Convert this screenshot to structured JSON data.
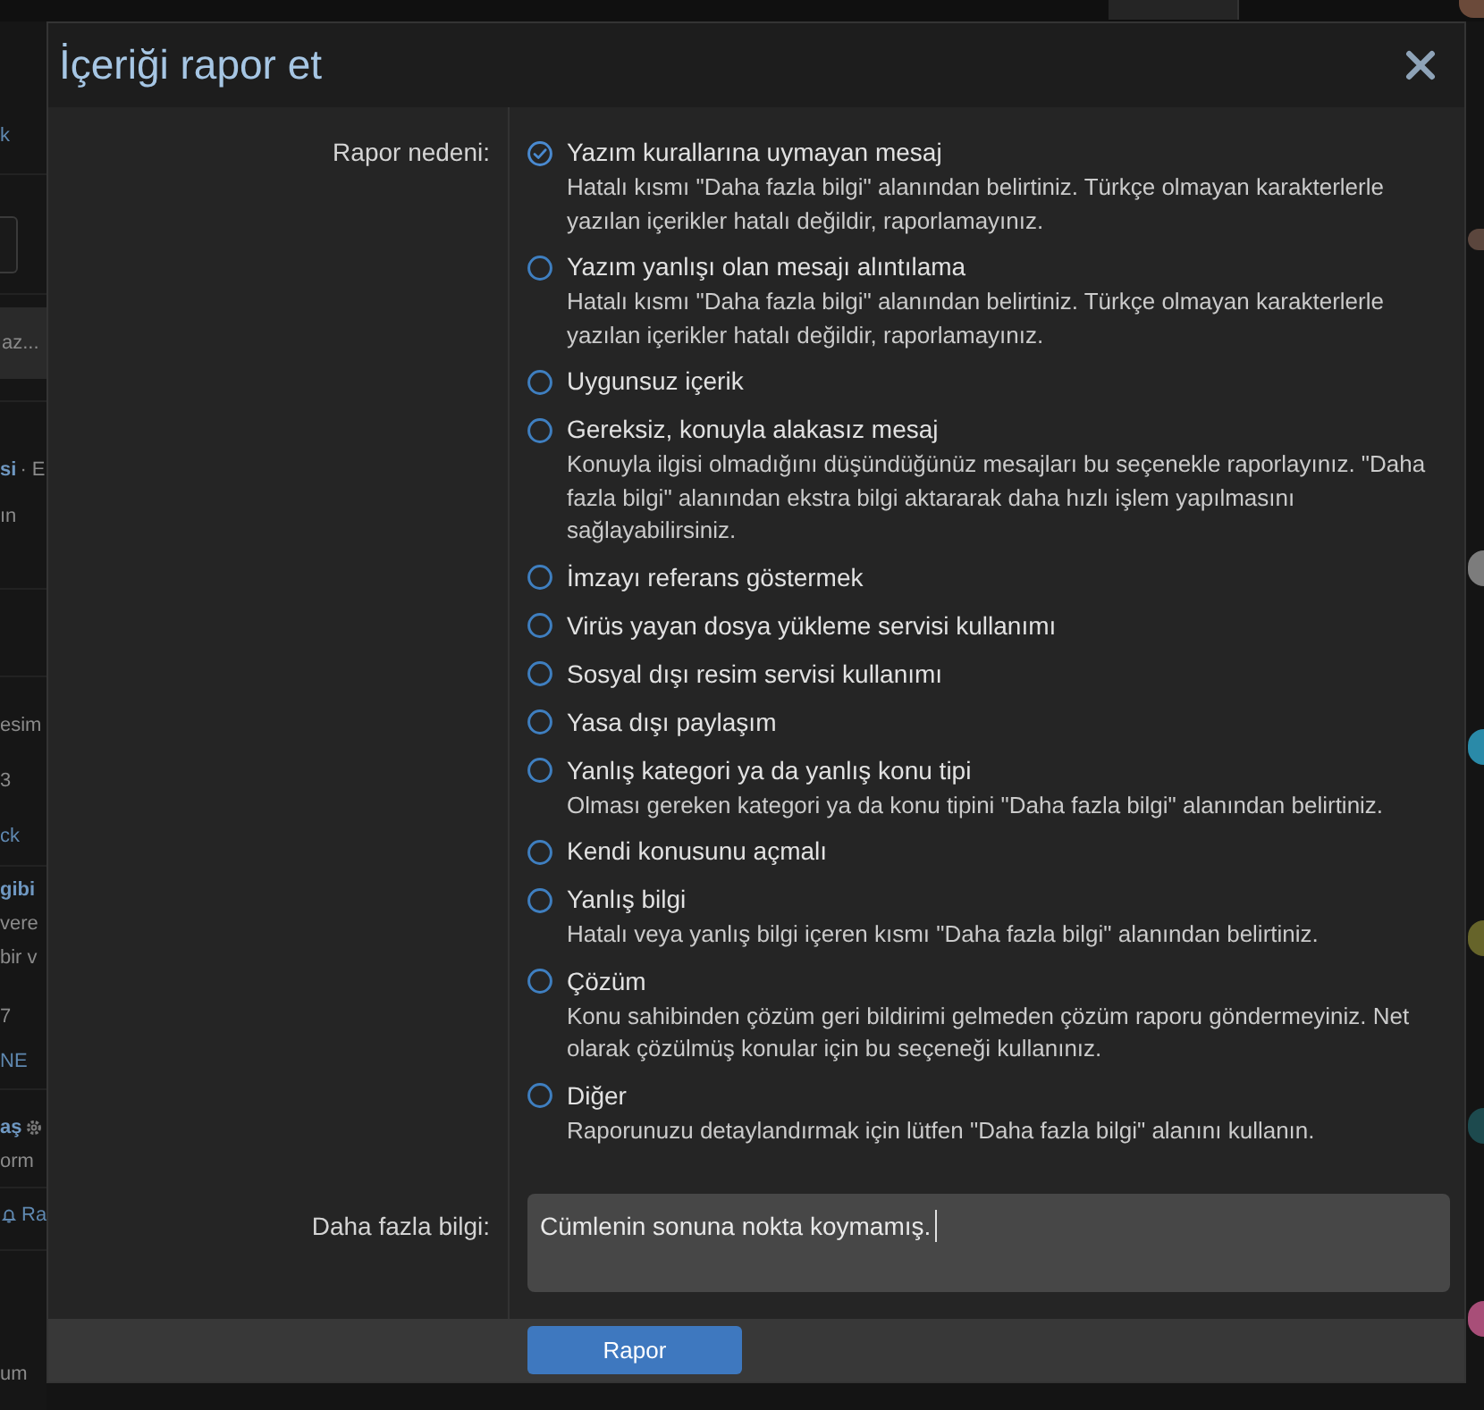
{
  "backdrop": {
    "left_sections": [
      {
        "rows": [
          [
            {
              "kind": "link",
              "text": "k"
            }
          ]
        ]
      },
      {
        "rows": [
          [
            {
              "kind": "field"
            }
          ]
        ]
      },
      {
        "rows": [
          [
            {
              "kind": "button",
              "text": "az..."
            }
          ]
        ]
      },
      {
        "rows": [
          [
            {
              "kind": "bold-link",
              "text": "si"
            },
            {
              "kind": "text",
              "text": "· E"
            }
          ],
          [
            {
              "kind": "text",
              "text": "ın"
            }
          ]
        ]
      },
      {
        "rows": [
          [
            {
              "kind": "text",
              "text": "esim"
            }
          ],
          [
            {
              "kind": "text",
              "text": "3"
            }
          ],
          [
            {
              "kind": "link",
              "text": "ck"
            }
          ]
        ]
      },
      {
        "rows": [
          [
            {
              "kind": "bold-link",
              "text": "gibi"
            }
          ],
          [
            {
              "kind": "text",
              "text": "vere"
            }
          ],
          [
            {
              "kind": "text",
              "text": "bir v"
            }
          ],
          [
            {
              "kind": "text",
              "text": "7"
            }
          ],
          [
            {
              "kind": "link",
              "text": "NE"
            }
          ]
        ]
      },
      {
        "rows": [
          [
            {
              "kind": "username",
              "text": "aş"
            }
          ],
          [
            {
              "kind": "text",
              "text": "orm"
            }
          ]
        ]
      },
      {
        "rows": [
          [
            {
              "kind": "alerts",
              "text": "Ra"
            }
          ]
        ]
      },
      {
        "rows": [
          [
            {
              "kind": "text",
              "text": "um"
            }
          ]
        ]
      }
    ]
  },
  "dialog": {
    "title": "İçeriği rapor et",
    "reason": {
      "label": "Rapor nedeni:",
      "options": [
        {
          "title": "Yazım kurallarına uymayan mesaj",
          "description": "Hatalı kısmı \"Daha fazla bilgi\" alanından belirtiniz. Türkçe olmayan karakterlerle yazılan içerikler hatalı değildir, raporlamayınız.",
          "selected": true
        },
        {
          "title": "Yazım yanlışı olan mesajı alıntılama",
          "description": "Hatalı kısmı \"Daha fazla bilgi\" alanından belirtiniz. Türkçe olmayan karakterlerle yazılan içerikler hatalı değildir, raporlamayınız.",
          "selected": false
        },
        {
          "title": "Uygunsuz içerik",
          "selected": false
        },
        {
          "title": "Gereksiz, konuyla alakasız mesaj",
          "description": "Konuyla ilgisi olmadığını düşündüğünüz mesajları bu seçenekle raporlayınız. \"Daha fazla bilgi\" alanından ekstra bilgi aktararak daha hızlı işlem yapılmasını sağlayabilirsiniz.",
          "selected": false
        },
        {
          "title": "İmzayı referans göstermek",
          "selected": false
        },
        {
          "title": "Virüs yayan dosya yükleme servisi kullanımı",
          "selected": false
        },
        {
          "title": "Sosyal dışı resim servisi kullanımı",
          "selected": false
        },
        {
          "title": "Yasa dışı paylaşım",
          "selected": false
        },
        {
          "title": "Yanlış kategori ya da yanlış konu tipi",
          "description": "Olması gereken kategori ya da konu tipini \"Daha fazla bilgi\" alanından belirtiniz.",
          "selected": false
        },
        {
          "title": "Kendi konusunu açmalı",
          "selected": false
        },
        {
          "title": "Yanlış bilgi",
          "description": "Hatalı veya yanlış bilgi içeren kısmı \"Daha fazla bilgi\" alanından belirtiniz.",
          "selected": false
        },
        {
          "title": "Çözüm",
          "description": "Konu sahibinden çözüm geri bildirimi gelmeden çözüm raporu göndermeyiniz. Net olarak çözülmüş konular için bu seçeneği kullanınız.",
          "selected": false
        },
        {
          "title": "Diğer",
          "description": "Raporunuzu detaylandırmak için lütfen \"Daha fazla bilgi\" alanını kullanın.",
          "selected": false
        }
      ]
    },
    "more_info": {
      "label": "Daha fazla bilgi:",
      "value": "Cümlenin sonuna nokta koymamış.",
      "focused": true
    },
    "submit": "Rapor"
  }
}
